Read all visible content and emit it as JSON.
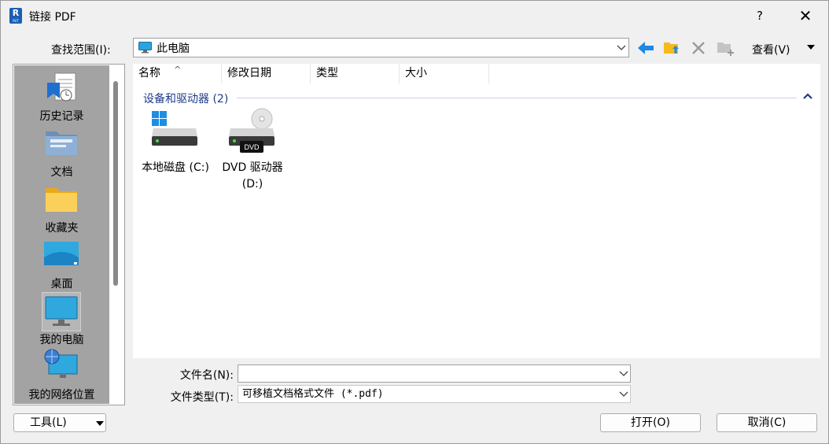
{
  "window": {
    "title": "链接 PDF",
    "app_icon_letter": "R",
    "app_icon_sub": "RVT",
    "help_label": "?",
    "close_label": "✕"
  },
  "lookin": {
    "label": "查找范围(I):",
    "value": "此电脑"
  },
  "toolbar": {
    "view_label": "查看(V)"
  },
  "places": [
    {
      "label": "历史记录",
      "icon": "history-icon"
    },
    {
      "label": "文档",
      "icon": "documents-icon"
    },
    {
      "label": "收藏夹",
      "icon": "favorites-folder-icon"
    },
    {
      "label": "桌面",
      "icon": "desktop-icon"
    },
    {
      "label": "我的电脑",
      "icon": "my-computer-icon",
      "selected": true
    },
    {
      "label": "我的网络位置",
      "icon": "network-icon"
    }
  ],
  "filelist": {
    "columns": [
      "名称",
      "修改日期",
      "类型",
      "大小"
    ],
    "group_title": "设备和驱动器 (2)",
    "items": [
      {
        "label": "本地磁盘 (C:)",
        "icon": "local-disk-icon"
      },
      {
        "label": "DVD 驱动器 (D:)",
        "icon": "dvd-drive-icon",
        "badge": "DVD"
      }
    ]
  },
  "filename": {
    "label": "文件名(N):",
    "value": ""
  },
  "filetype": {
    "label": "文件类型(T):",
    "value": "可移植文档格式文件 (*.pdf)"
  },
  "buttons": {
    "tools": "工具(L)",
    "open": "打开(O)",
    "cancel": "取消(C)"
  }
}
